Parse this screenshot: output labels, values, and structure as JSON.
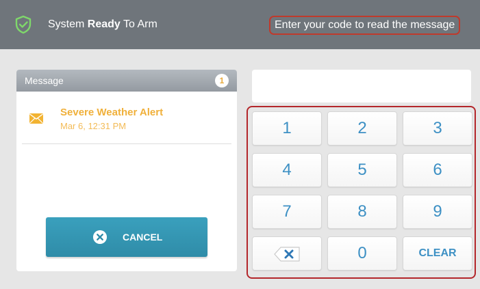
{
  "header": {
    "status_prefix": "System",
    "status_strong": "Ready",
    "status_suffix": "To Arm",
    "message_prompt": "Enter your code to read the message",
    "shield_icon": "shield-check-icon"
  },
  "message_panel": {
    "title": "Message",
    "count": "1",
    "items": [
      {
        "icon": "envelope-icon",
        "title": "Severe Weather Alert",
        "time": "Mar 6, 12:31 PM"
      }
    ],
    "cancel_label": "CANCEL",
    "cancel_icon": "close-circle-icon"
  },
  "code_display": {
    "value": ""
  },
  "keypad": {
    "keys": [
      "1",
      "2",
      "3",
      "4",
      "5",
      "6",
      "7",
      "8",
      "9",
      "backspace",
      "0",
      "CLEAR"
    ],
    "backspace_icon": "backspace-icon",
    "clear_label": "CLEAR"
  },
  "colors": {
    "header_bg": "#6f757b",
    "accent": "#3d90c4",
    "message_highlight": "#f0b03a",
    "cancel_button": "#3aa0bd",
    "outline_red": "#b3262a"
  }
}
